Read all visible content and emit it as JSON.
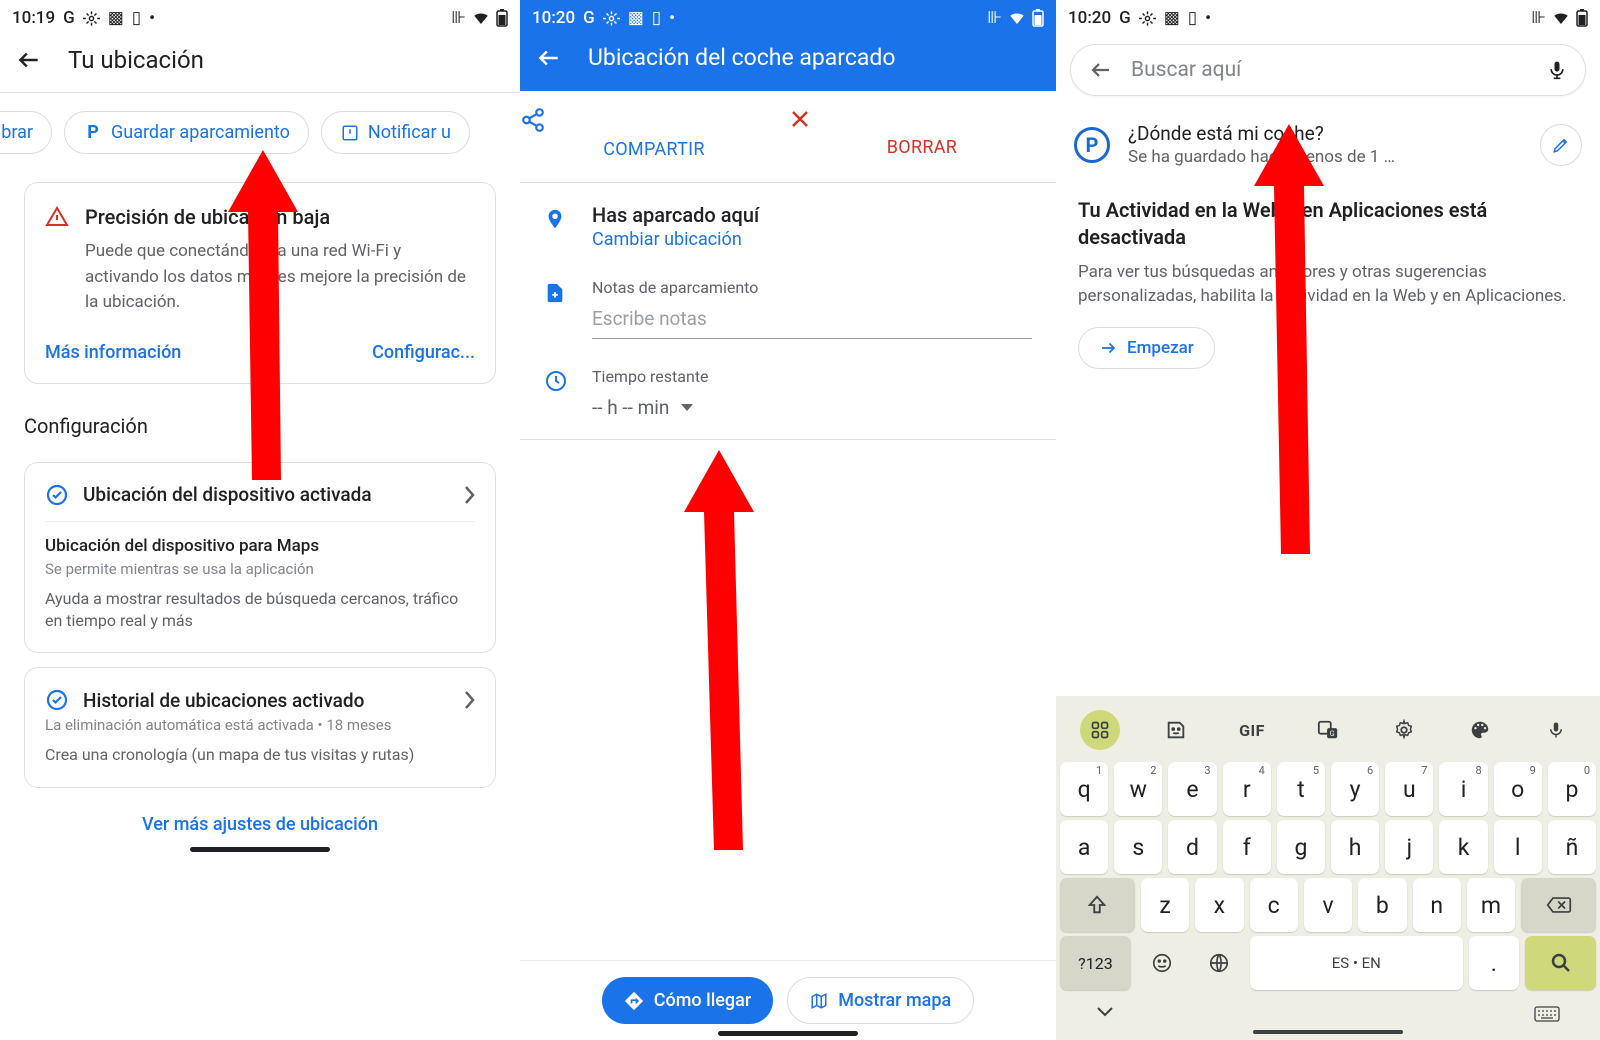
{
  "phone1": {
    "status": {
      "time": "10:19"
    },
    "title": "Tu ubicación",
    "chips": {
      "calibrate": "Calibrar",
      "save": "Guardar aparcamiento",
      "notify": "Notificar u"
    },
    "card": {
      "title": "Precisión de ubicación baja",
      "body": "Puede que conectándote a una red Wi-Fi y activando los datos móviles mejore la precisión de la ubicación.",
      "more": "Más información",
      "config": "Configurac..."
    },
    "section": "Configuración",
    "setting1": {
      "title": "Ubicación del dispositivo activada",
      "subtitle": "Ubicación del dispositivo para Maps",
      "subdesc": "Se permite mientras se usa la aplicación",
      "body": "Ayuda a mostrar resultados de búsqueda cercanos, tráfico en tiempo real y más"
    },
    "setting2": {
      "title": "Historial de ubicaciones activado",
      "subdesc": "La eliminación automática está activada • 18 meses",
      "body": "Crea una cronología (un mapa de tus visitas y rutas)"
    },
    "more_link": "Ver más ajustes de ubicación"
  },
  "phone2": {
    "status": {
      "time": "10:20"
    },
    "title": "Ubicación del coche aparcado",
    "share": "COMPARTIR",
    "delete": "BORRAR",
    "parked": {
      "title": "Has aparcado aquí",
      "link": "Cambiar ubicación"
    },
    "notes": {
      "label": "Notas de aparcamiento",
      "placeholder": "Escribe notas"
    },
    "time": {
      "label": "Tiempo restante",
      "value": "-- h -- min"
    },
    "directions": "Cómo llegar",
    "show_map": "Mostrar mapa"
  },
  "phone3": {
    "status": {
      "time": "10:20"
    },
    "search_placeholder": "Buscar aquí",
    "result": {
      "title": "¿Dónde está mi coche?",
      "subtitle": "Se ha guardado hace menos de 1 …"
    },
    "waa": {
      "title": "Tu Actividad en la Web y en Aplicaciones está desactivada",
      "body": "Para ver tus búsquedas anteriores y otras sugerencias personalizadas, habilita la Actividad en la Web y en Aplicaciones.",
      "button": "Empezar"
    },
    "keyboard": {
      "gif": "GIF",
      "row1": [
        "q",
        "w",
        "e",
        "r",
        "t",
        "y",
        "u",
        "i",
        "o",
        "p"
      ],
      "sup1": [
        "1",
        "2",
        "3",
        "4",
        "5",
        "6",
        "7",
        "8",
        "9",
        "0"
      ],
      "row2": [
        "a",
        "s",
        "d",
        "f",
        "g",
        "h",
        "j",
        "k",
        "l",
        "ñ"
      ],
      "row3": [
        "z",
        "x",
        "c",
        "v",
        "b",
        "n",
        "m"
      ],
      "num": "?123",
      "lang": "ES • EN",
      "dot": "."
    }
  }
}
